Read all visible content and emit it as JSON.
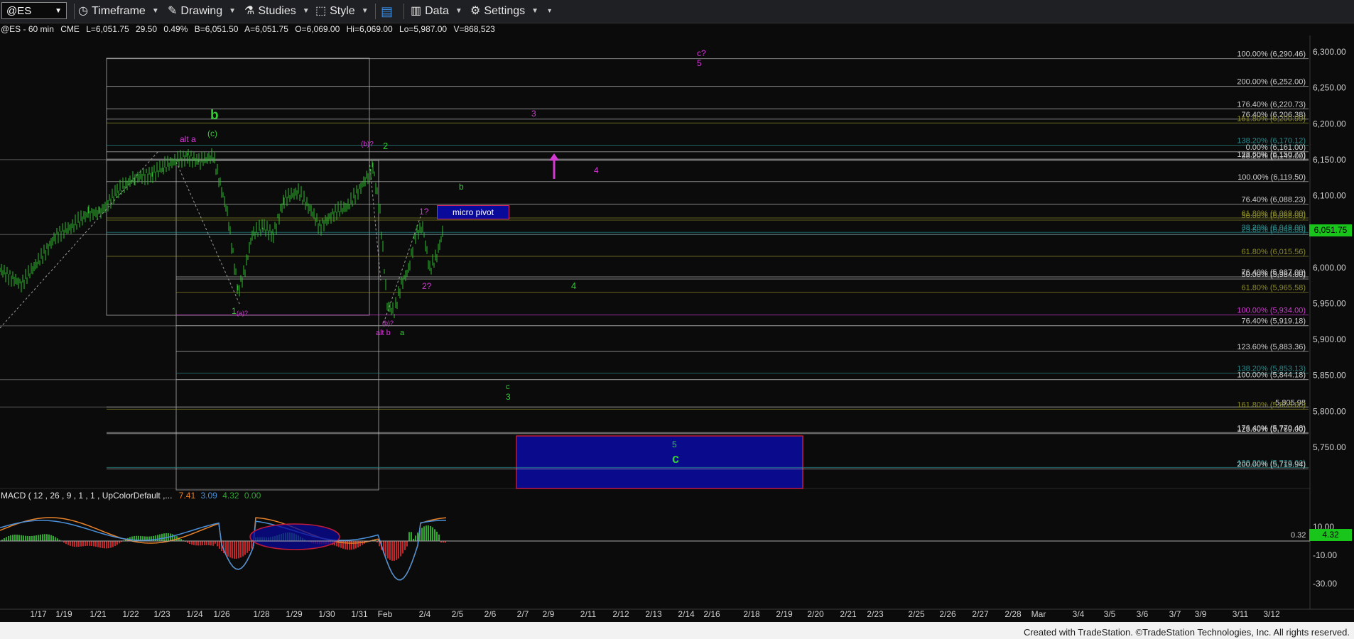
{
  "toolbar": {
    "symbol": "@ES",
    "timeframe": "Timeframe",
    "drawing": "Drawing",
    "studies": "Studies",
    "style": "Style",
    "data": "Data",
    "settings": "Settings"
  },
  "quote": {
    "title": "@ES - 60 min",
    "exchange": "CME",
    "last": "L=6,051.75",
    "change": "29.50",
    "pct": "0.49%",
    "bid": "B=6,051.50",
    "ask": "A=6,051.75",
    "open": "O=6,069.00",
    "high": "Hi=6,069.00",
    "low": "Lo=5,987.00",
    "volume": "V=868,523"
  },
  "price_axis": [
    "6,300.00",
    "6,250.00",
    "6,200.00",
    "6,150.00",
    "6,100.00",
    "6,050.00",
    "6,000.00",
    "5,950.00",
    "5,900.00",
    "5,850.00",
    "5,800.00",
    "5,750.00"
  ],
  "last_price_tag": "6,051.75",
  "macd": {
    "label": "MACD ( 12 , 26 , 9 , 1 , 1 , UpColorDefault ,...",
    "v1": "7.41",
    "v2": "3.09",
    "v3": "4.32",
    "v4": "0.00",
    "axis": [
      "10.00",
      "-10.00",
      "-30.00"
    ],
    "zero_label": "0.32",
    "tag": "4.32",
    "colors": {
      "macd": "#4a90d9",
      "signal": "#e8832a",
      "hist_pos": "#2ea82e",
      "hist_neg": "#c0262a"
    }
  },
  "fib_labels": [
    "100.00% (6,290.46)",
    "200.00% (6,252.00)",
    "176.40% (6,220.73)",
    "76.40% (6,206.38)",
    "161.80% (6,200.99)",
    "138.20% (6,170.12)",
    "0.00% (6,161.00)",
    "123.60% (6,150.77)",
    "38.20% (6,149.00)",
    "100.00% (6,119.50)",
    "76.40% (6,088.23)",
    "61.80% (6,069.00)",
    "50.00% (6,066.00)",
    "38.20% (6,049.00)",
    "23.60% (6,046.00)",
    "61.80% (6,015.56)",
    "76.40% (5,987.00)",
    "50.00% (5,984.00)",
    "61.80% (5,965.58)",
    "100.00% (5,934.00)",
    "76.40% (5,919.18)",
    "123.60% (5,883.36)",
    "138.20% (5,853.13)",
    "100.00% (5,844.18)",
    "5,805.98",
    "161.80% (5,803.00)",
    "176.40% (5,770.48)",
    "123.60% (5,769.00)",
    "138.20% (5,722.00)",
    "200.00% (5,719.94)"
  ],
  "wave_labels": {
    "b_big": "b",
    "c_paren": "(c)",
    "alt_a": "alt a",
    "b_paren_q": "(b)?",
    "two": "2",
    "b_small": "b",
    "one_q": "1?",
    "micro_pivot": "micro pivot",
    "two_q": "2?",
    "four_green": "4",
    "one": "1",
    "a_paren_q": "(a)?",
    "b_paren_q2": "(b)?",
    "alt_b": "alt b",
    "a": "a",
    "c_small": "c",
    "three_green": "3",
    "five_green": "5",
    "c_big": "c",
    "three_mag": "3",
    "four_mag": "4",
    "c_q": "c?",
    "five_mag": "5"
  },
  "date_axis": [
    "1/17",
    "1/19",
    "1/21",
    "1/22",
    "1/23",
    "1/24",
    "1/26",
    "1/28",
    "1/29",
    "1/30",
    "1/31",
    "Feb",
    "2/4",
    "2/5",
    "2/6",
    "2/7",
    "2/9",
    "2/11",
    "2/12",
    "2/13",
    "2/14",
    "2/16",
    "2/18",
    "2/19",
    "2/20",
    "2/21",
    "2/23",
    "2/25",
    "2/26",
    "2/27",
    "2/28",
    "Mar",
    "3/4",
    "3/5",
    "3/6",
    "3/7",
    "3/9",
    "3/11",
    "3/12"
  ],
  "footer": "Created with TradeStation. ©TradeStation Technologies, Inc. All rights reserved.",
  "colors": {
    "up": "#2dbb2d",
    "magenta": "#d23ad2",
    "green_label": "#33cc33",
    "target_box": "#0a0a8c",
    "target_border": "#c01b3a"
  }
}
